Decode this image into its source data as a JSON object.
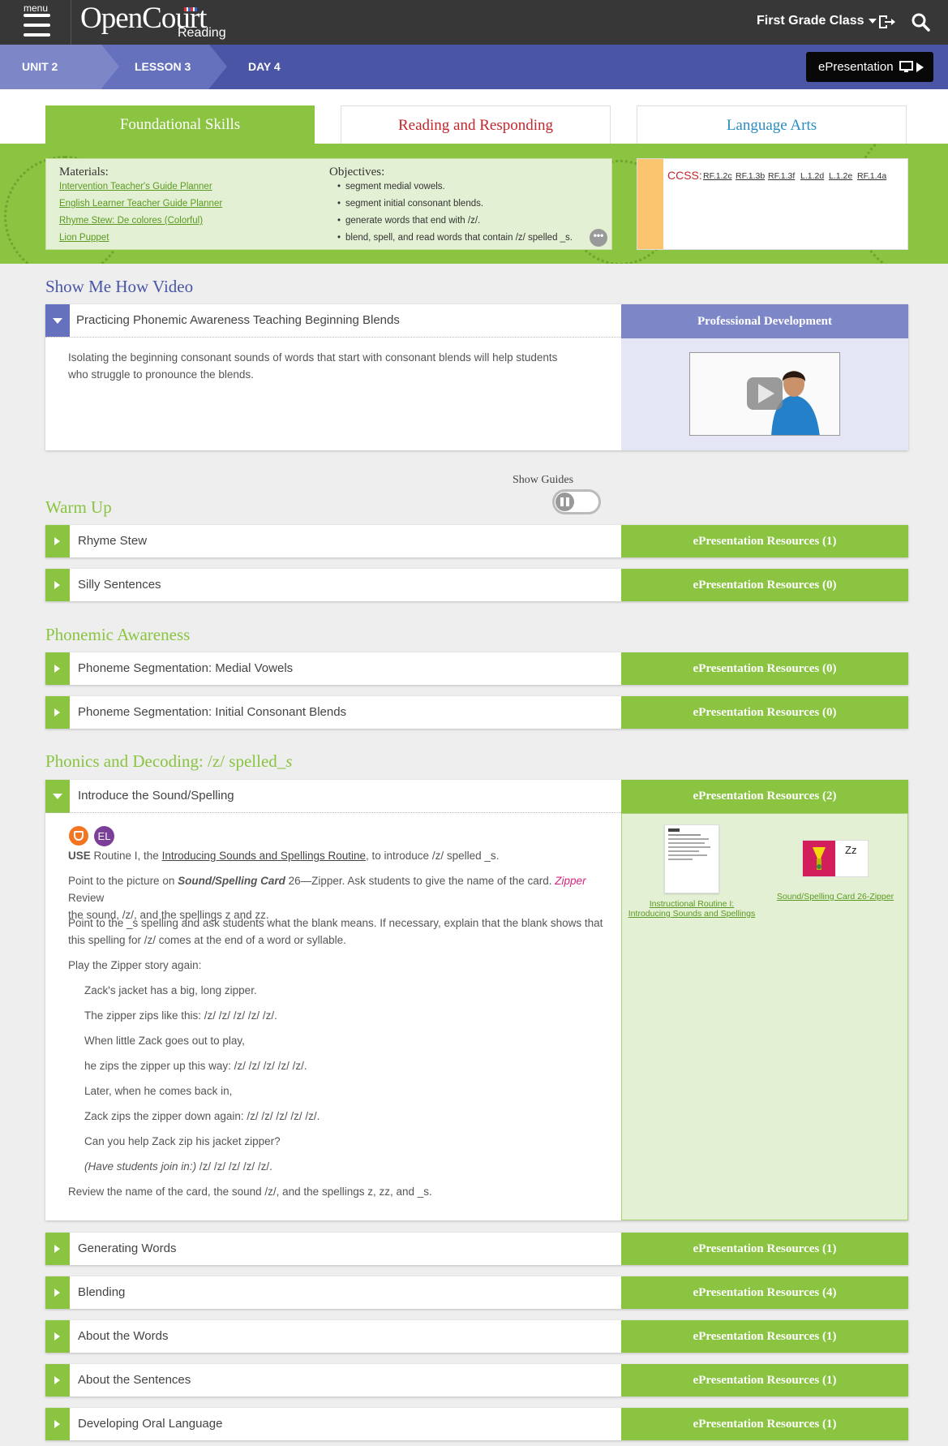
{
  "app": {
    "menu_label": "menu",
    "logo_main": "OpenCourt",
    "logo_sub": "Reading",
    "class_selector": "First Grade Class"
  },
  "breadcrumbs": [
    "UNIT 2",
    "LESSON 3",
    "DAY 4"
  ],
  "epresentation_button": "ePresentation",
  "tabs": [
    "Foundational Skills",
    "Reading and Responding",
    "Language Arts"
  ],
  "materials": {
    "heading": "Materials:",
    "items": [
      "Intervention Teacher's Guide Planner",
      "English Learner Teacher Guide Planner",
      "Rhyme Stew: De colores (Colorful)",
      "Lion Puppet"
    ]
  },
  "objectives": {
    "heading": "Objectives:",
    "items": [
      "segment medial vowels.",
      "segment initial consonant blends.",
      "generate words that end with /z/.",
      "blend, spell, and read words that contain /z/ spelled _s."
    ]
  },
  "ccss": {
    "label": "CCSS:",
    "codes": [
      "RF.1.2c",
      "RF.1.3b",
      "RF.1.3f",
      "L.1.2d",
      "L.1.2e",
      "RF.1.4a"
    ]
  },
  "video_section": {
    "title": "Show Me How Video",
    "item_title": "Practicing Phonemic Awareness Teaching Beginning Blends",
    "description": "Isolating the beginning consonant sounds of words that start with consonant blends will help students who struggle to pronounce the blends.",
    "pd_header": "Professional Development"
  },
  "show_guides": "Show Guides",
  "warm_up": {
    "title": "Warm Up",
    "rows": [
      {
        "label": "Rhyme Stew",
        "resources": "ePresentation Resources (1)"
      },
      {
        "label": "Silly Sentences",
        "resources": "ePresentation Resources (0)"
      }
    ]
  },
  "phonemic": {
    "title": "Phonemic Awareness",
    "rows": [
      {
        "label": "Phoneme Segmentation: Medial Vowels",
        "resources": "ePresentation Resources (0)"
      },
      {
        "label": "Phoneme Segmentation: Initial Consonant Blends",
        "resources": "ePresentation Resources (0)"
      }
    ]
  },
  "phonics": {
    "title_prefix": "Phonics and Decoding: /z/ spelled",
    "title_suffix": "_s",
    "expanded": {
      "label": "Introduce the Sound/Spelling",
      "resources": "ePresentation Resources (2)",
      "badge_el": "EL",
      "use_word": "USE",
      "use_pre": " Routine I, the ",
      "use_link": "Introducing Sounds and Spellings Routine",
      "use_post": ", to introduce /z/ spelled _s.",
      "p2_pre": "Point to the picture on ",
      "p2_card": "Sound/Spelling Card",
      "p2_mid": " 26—Zipper. Ask students to give the name of the card. ",
      "p2_zipper": "Zipper",
      "p2_post1": " Review",
      "p2_line2": "the sound, /z/, and the spellings z and zz.",
      "p3_line1": "Point to the _s spelling and ask students what the blank means. If necessary, explain that the blank shows that",
      "p3_line2": "this spelling for /z/ comes at the end of a word or syllable.",
      "p4": "Play the Zipper story again:",
      "poem": [
        "Zack's jacket has a big, long zipper.",
        "The zipper zips like this: /z/ /z/ /z/ /z/ /z/.",
        "When little Zack goes out to play,",
        "he zips the zipper up this way: /z/ /z/ /z/ /z/ /z/.",
        "Later, when he comes back in,",
        "Zack zips the zipper down again: /z/ /z/ /z/ /z/ /z/.",
        "Can you help Zack zip his jacket zipper?"
      ],
      "poem_last_italic": "(Have students join in:)",
      "poem_last_rest": " /z/ /z/ /z/ /z/ /z/.",
      "review": "Review the name of the card, the sound /z/, and the spellings z, zz, and _s.",
      "res_link_1a": "Instructional Routine I:",
      "res_link_1b": "Introducing Sounds and Spellings",
      "res_link_2": "Sound/Spelling Card 26-Zipper",
      "card_text": "Zz"
    },
    "rows": [
      {
        "label": "Generating Words",
        "resources": "ePresentation Resources (1)"
      },
      {
        "label": "Blending",
        "resources": "ePresentation Resources (4)"
      },
      {
        "label": "About the Words",
        "resources": "ePresentation Resources (1)"
      },
      {
        "label": "About the Sentences",
        "resources": "ePresentation Resources (1)"
      },
      {
        "label": "Developing Oral Language",
        "resources": "ePresentation Resources (1)"
      }
    ]
  },
  "colors": {
    "green": "#8ac441",
    "purple": "#4a56a5",
    "pd_header": "#7d87c8",
    "red": "#c2262e",
    "blue": "#2a8cbf"
  }
}
